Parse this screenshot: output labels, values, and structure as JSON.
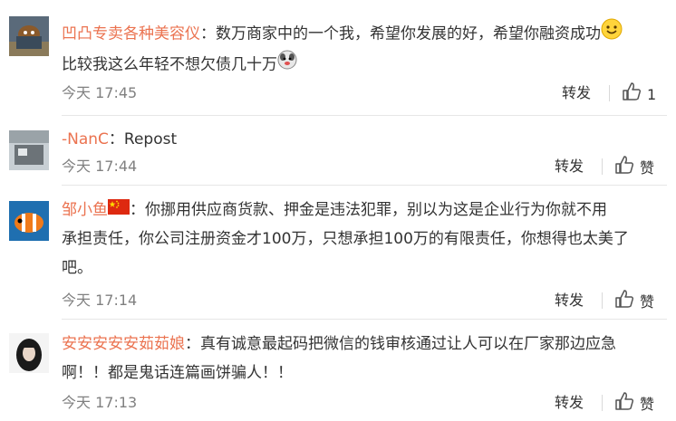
{
  "comments": [
    {
      "username": "凹凸专卖各种美容仪",
      "colon": "：",
      "line1": "数万商家中的一个我，希望你发展的好，希望你融资成功",
      "line2": "比较我这么年轻不想欠债几十万",
      "emoji1": "smile-emoji",
      "emoji2": "dog-face-emoji",
      "time": "今天 17:45",
      "repost_label": "转发",
      "like_label": "1"
    },
    {
      "username": "-NanC",
      "colon": "：",
      "line1": "Repost",
      "time": "今天 17:44",
      "repost_label": "转发",
      "like_label": "赞"
    },
    {
      "username": "邹小鱼",
      "flag": "china-flag",
      "colon": "：",
      "line1": "你挪用供应商货款、押金是违法犯罪，别以为这是企业行为你就不用",
      "line2": "承担责任，你公司注册资金才100万，只想承担100万的有限责任，你想得也太美了",
      "line3": "吧。",
      "time": "今天 17:14",
      "repost_label": "转发",
      "like_label": "赞"
    },
    {
      "username": "安安安安安茹茹娘",
      "colon": "：",
      "line1": "真有诚意最起码把微信的钱审核通过让人可以在厂家那边应急",
      "line2": "啊！！都是鬼话连篇画饼骗人！！",
      "time": "今天 17:13",
      "repost_label": "转发",
      "like_label": "赞"
    }
  ],
  "colors": {
    "username": "#eb7350",
    "text": "#333333",
    "meta": "#808080"
  }
}
